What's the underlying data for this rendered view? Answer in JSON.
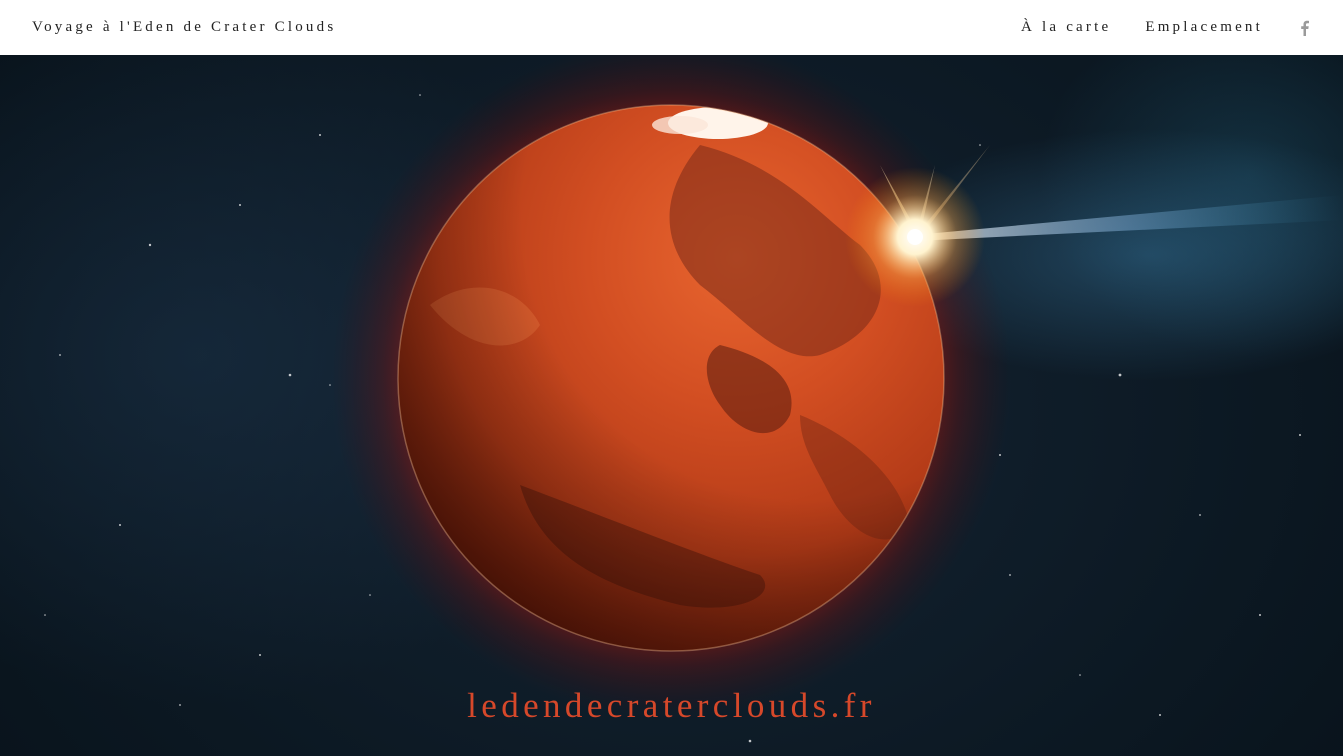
{
  "navbar": {
    "brand": "Voyage à l'Eden de Crater Clouds",
    "links": [
      {
        "label": "À la carte"
      },
      {
        "label": "Emplacement"
      }
    ],
    "social_icon": "facebook-icon"
  },
  "hero": {
    "image": "planet-mars-with-sun-flare",
    "site_url": "ledendecraterclouds.fr"
  },
  "colors": {
    "navbar_bg": "#ffffff",
    "nav_text": "#222222",
    "url_text": "#d6482a",
    "space_bg": "#0d1a25",
    "planet": "#c8401e"
  }
}
